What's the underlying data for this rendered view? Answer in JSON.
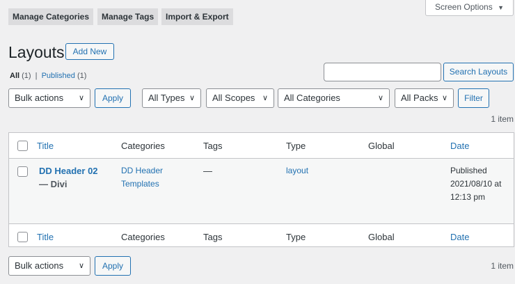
{
  "tabs": [
    "Manage Categories",
    "Manage Tags",
    "Import & Export"
  ],
  "screen_options": "Screen Options",
  "screen_options_arrow": "▼",
  "page": {
    "title": "Layouts",
    "add_new": "Add New"
  },
  "filters_views": {
    "all_label": "All",
    "all_count": "(1)",
    "separator": "|",
    "published_label": "Published",
    "published_count": "(1)"
  },
  "search": {
    "value": "",
    "button": "Search Layouts"
  },
  "top_nav": {
    "bulk_actions": "Bulk actions",
    "apply": "Apply",
    "types": "All Types",
    "scopes": "All Scopes",
    "categories": "All Categories",
    "packs": "All Packs",
    "filter": "Filter",
    "count": "1 item"
  },
  "columns": {
    "title": "Title",
    "categories": "Categories",
    "tags": "Tags",
    "type": "Type",
    "global": "Global",
    "date": "Date"
  },
  "row": {
    "title_line1": "DD Header 02",
    "title_line2": "— Divi",
    "category_line1": "DD Header",
    "category_line2": "Templates",
    "tags": "—",
    "type": "layout",
    "date_line1": "Published",
    "date_line2": "2021/08/10 at",
    "date_line3": "12:13 pm"
  },
  "bottom_nav": {
    "bulk_actions": "Bulk actions",
    "apply": "Apply",
    "count": "1 item"
  },
  "icons": {
    "chevron": "chevron-down-icon"
  },
  "colors": {
    "link": "#2271b1",
    "background": "#f0f0f1"
  }
}
